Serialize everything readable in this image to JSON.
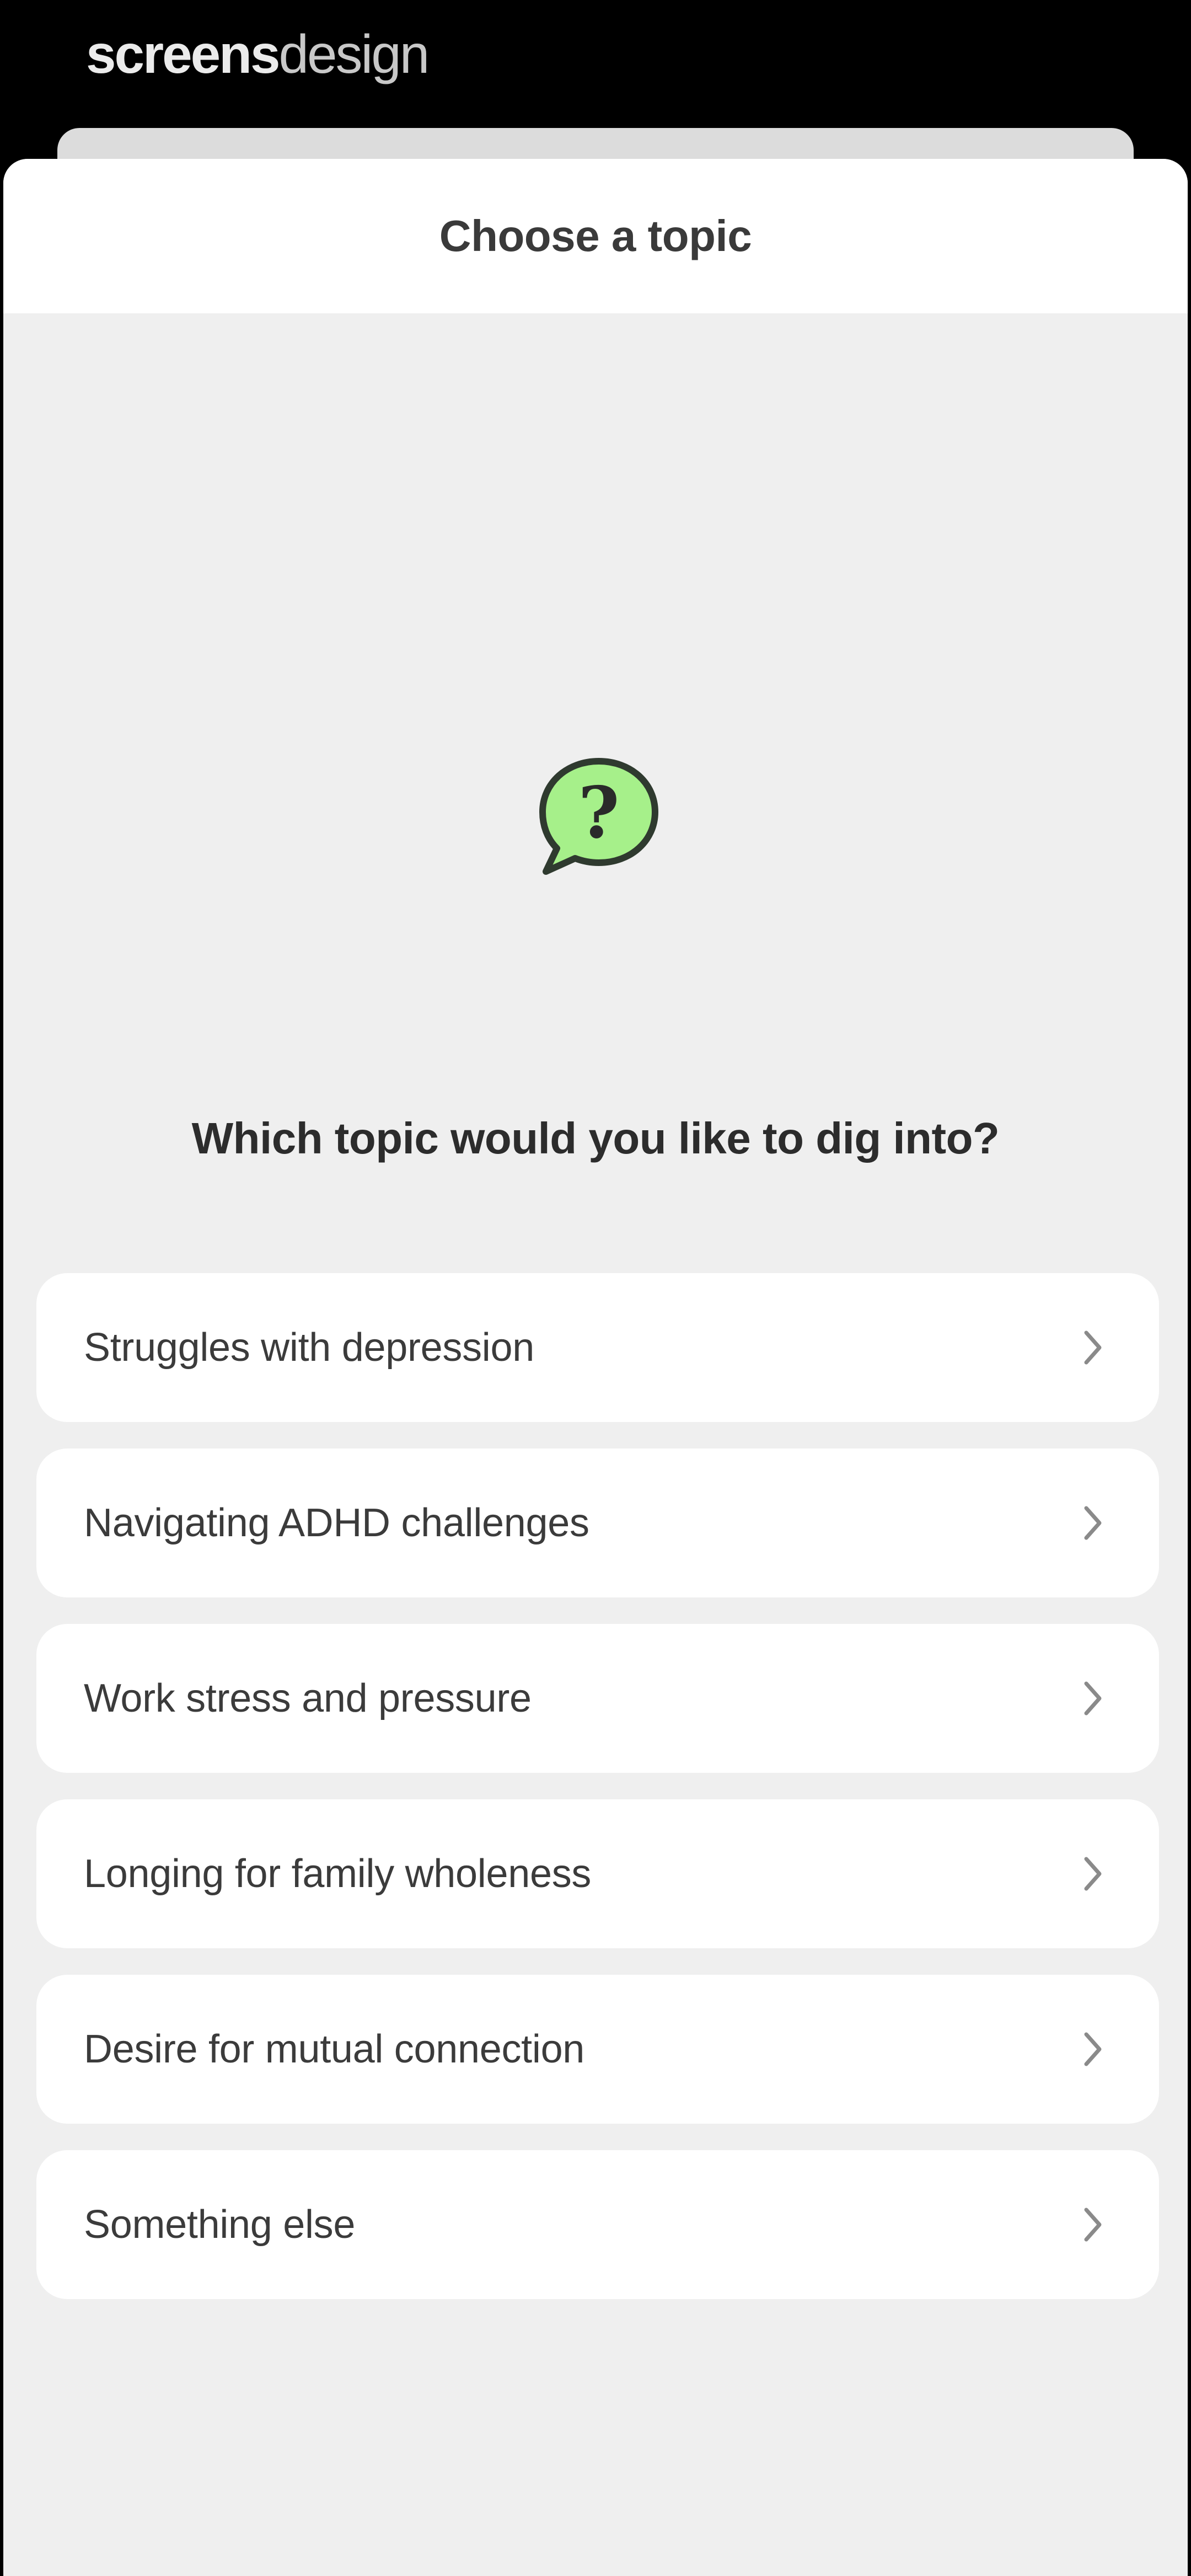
{
  "watermark": {
    "brand_bold": "screens",
    "brand_light": "design"
  },
  "sheet": {
    "title": "Choose a topic"
  },
  "main": {
    "icon": "question-speech-bubble-icon",
    "prompt": "Which topic would you like to dig into?",
    "topics": [
      {
        "label": "Struggles with depression"
      },
      {
        "label": "Navigating ADHD challenges"
      },
      {
        "label": "Work stress and pressure"
      },
      {
        "label": "Longing for family wholeness"
      },
      {
        "label": "Desire for mutual connection"
      },
      {
        "label": "Something else"
      }
    ]
  },
  "colors": {
    "background": "#000000",
    "sheet": "#efefef",
    "card": "#ffffff",
    "bubble_fill": "#a6f08a",
    "text": "#3b3b3b"
  }
}
